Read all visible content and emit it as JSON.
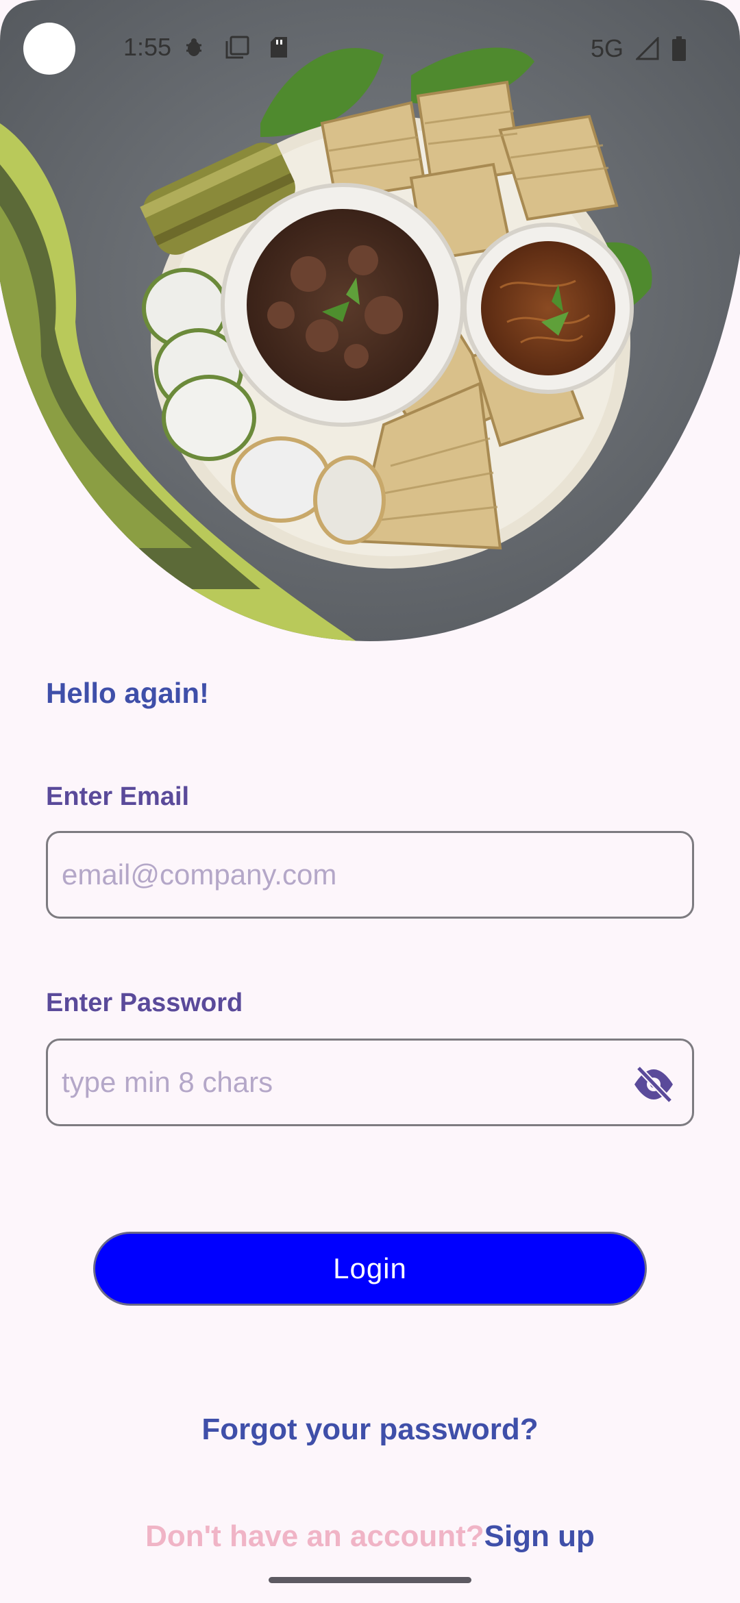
{
  "status_bar": {
    "time": "1:55",
    "network": "5G",
    "icons": [
      "bug-icon",
      "copy-icon",
      "sd-card-icon",
      "signal-icon",
      "battery-icon"
    ]
  },
  "hero": {
    "icon": "food-platter-image"
  },
  "login": {
    "greeting": "Hello again!",
    "email_label": "Enter Email",
    "email_placeholder": "email@company.com",
    "email_value": "",
    "password_label": "Enter Password",
    "password_placeholder": "type min 8 chars",
    "password_value": "",
    "password_toggle_icon": "eye-off-icon",
    "login_label": "Login",
    "forgot_label": "Forgot your password?",
    "signup_prompt": "Don't have an account?",
    "signup_label": "Sign up"
  },
  "colors": {
    "background": "#fdf6fb",
    "accent": "#3f4fa9",
    "label": "#5a4a9a",
    "button": "#0000ff",
    "prompt": "#f0b4c6"
  }
}
